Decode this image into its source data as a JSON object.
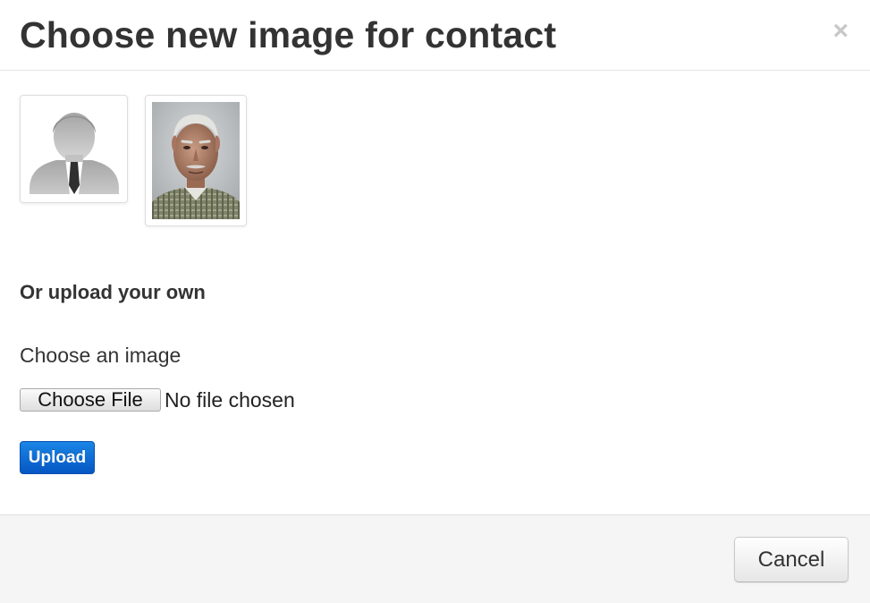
{
  "modal": {
    "title": "Choose new image for contact",
    "close_symbol": "×"
  },
  "images": [
    {
      "name": "default-avatar",
      "icon": "person-silhouette-icon"
    },
    {
      "name": "portrait-photo",
      "icon": "elderly-man-portrait"
    }
  ],
  "upload": {
    "heading": "Or upload your own",
    "field_label": "Choose an image",
    "file_button_label": "Choose File",
    "file_status": "No file chosen",
    "upload_button_label": "Upload"
  },
  "footer": {
    "cancel_label": "Cancel"
  },
  "colors": {
    "primary_button": "#0a66d3",
    "footer_background": "#f5f5f5",
    "text": "#333333",
    "close": "#c8c8c8"
  }
}
